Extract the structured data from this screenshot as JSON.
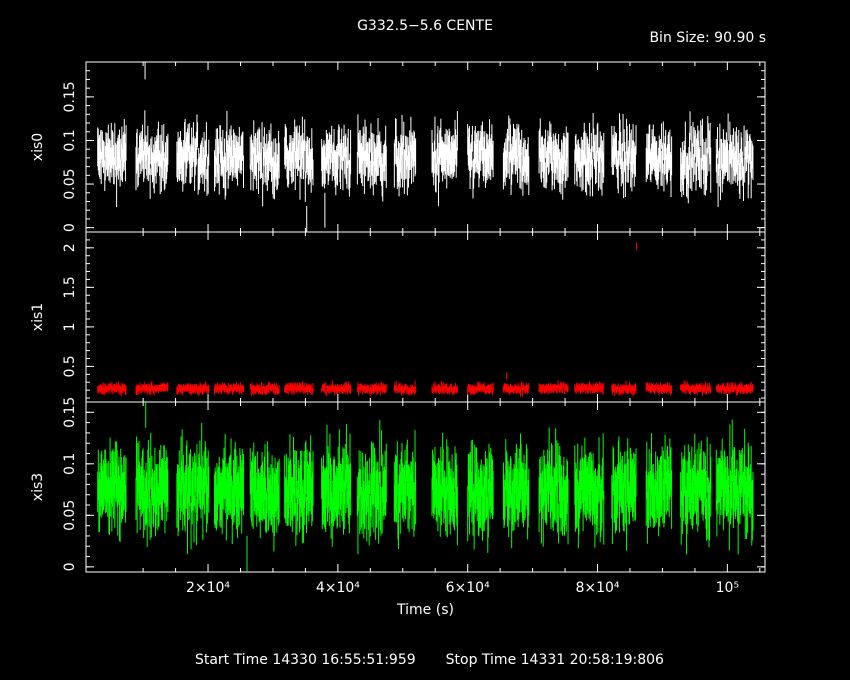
{
  "chart_data": {
    "type": "line",
    "title": "G332.5−5.6 CENTE",
    "bin_size_label": "Bin Size: 90.90 s",
    "xlabel": "Time (s)",
    "xlim": [
      1200,
      105800
    ],
    "xticks": [
      20000,
      40000,
      60000,
      80000,
      100000
    ],
    "xtick_labels": [
      "2×10⁴",
      "4×10⁴",
      "6×10⁴",
      "8×10⁴",
      "10⁵"
    ],
    "panels": [
      {
        "ylabel": "xis0",
        "color": "#ffffff",
        "ylim": [
          -0.005,
          0.19
        ],
        "yticks": [
          0,
          0.05,
          0.1,
          0.15
        ],
        "ytick_labels": [
          "0",
          "0.05",
          "0.1",
          "0.15"
        ],
        "mean": 0.08,
        "scatter": 0.025,
        "err": 0.02,
        "outliers": [
          [
            10300,
            0.19
          ],
          [
            35200,
            0.005
          ],
          [
            38000,
            0.02
          ],
          [
            55500,
            0.045
          ]
        ]
      },
      {
        "ylabel": "xis1",
        "color": "#ff0000",
        "ylim": [
          0.05,
          2.2
        ],
        "yticks": [
          0.5,
          1,
          1.5,
          2
        ],
        "ytick_labels": [
          "0.5",
          "1",
          "1.5",
          "2"
        ],
        "mean": 0.22,
        "scatter": 0.04,
        "err": 0.045,
        "outliers": [
          [
            86000,
            2.02
          ],
          [
            66000,
            0.38
          ]
        ]
      },
      {
        "ylabel": "xis3",
        "color": "#00ff00",
        "ylim": [
          -0.005,
          0.16
        ],
        "yticks": [
          0,
          0.05,
          0.1,
          0.15
        ],
        "ytick_labels": [
          "0",
          "0.05",
          "0.1",
          "0.15"
        ],
        "mean": 0.075,
        "scatter": 0.028,
        "err": 0.025,
        "outliers": [
          [
            10400,
            0.16
          ],
          [
            26000,
            0.005
          ]
        ]
      }
    ],
    "observing_segments": [
      [
        3000,
        7400
      ],
      [
        8900,
        13900
      ],
      [
        15200,
        20200
      ],
      [
        21000,
        25500
      ],
      [
        26500,
        31000
      ],
      [
        31800,
        36200
      ],
      [
        37500,
        42000
      ],
      [
        43000,
        47500
      ],
      [
        48700,
        52000
      ],
      [
        54500,
        58500
      ],
      [
        60000,
        64000
      ],
      [
        65500,
        69500
      ],
      [
        71000,
        75500
      ],
      [
        76500,
        81000
      ],
      [
        82200,
        86000
      ],
      [
        87500,
        91500
      ],
      [
        92800,
        97500
      ],
      [
        98300,
        104000
      ]
    ]
  },
  "footer": {
    "start_time": "Start Time 14330 16:55:51:959",
    "stop_time": "Stop Time 14331 20:58:19:806"
  }
}
